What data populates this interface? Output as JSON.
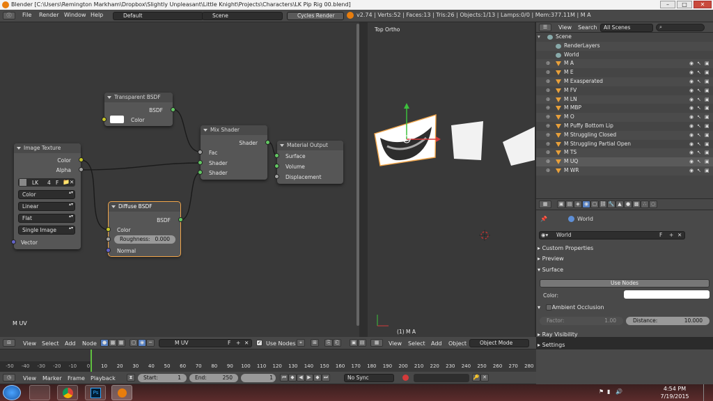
{
  "title": "Blender [C:\\Users\\Remington Markham\\Dropbox\\Slightly Unpleasant\\Little Knight\\Projects\\Characters\\LK Pip Rig 00.blend]",
  "info_header": {
    "menus": [
      "File",
      "Render",
      "Window",
      "Help"
    ],
    "layout": "Default",
    "scene": "Scene",
    "engine": "Cycles Render",
    "stats": "v2.74 | Verts:52 | Faces:13 | Tris:26 | Objects:1/13 | Lamps:0/0 | Mem:377.11M | M A"
  },
  "nodes": {
    "transparent": {
      "title": "Transparent BSDF",
      "out": "BSDF",
      "in": "Color"
    },
    "image": {
      "title": "Image Texture",
      "out_color": "Color",
      "out_alpha": "Alpha",
      "image_name": "LK",
      "users": "4",
      "f": "F",
      "color": "Color",
      "interp": "Linear",
      "proj": "Flat",
      "source": "Single Image",
      "vector": "Vector"
    },
    "diffuse": {
      "title": "Diffuse BSDF",
      "out": "BSDF",
      "color": "Color",
      "roughness_label": "Roughness:",
      "roughness": "0.000",
      "normal": "Normal"
    },
    "mix": {
      "title": "Mix Shader",
      "out": "Shader",
      "fac": "Fac",
      "shader1": "Shader",
      "shader2": "Shader"
    },
    "output": {
      "title": "Material Output",
      "surface": "Surface",
      "volume": "Volume",
      "displacement": "Displacement"
    }
  },
  "node_editor": {
    "label": "M UV",
    "header": {
      "menus": [
        "View",
        "Select",
        "Add",
        "Node"
      ],
      "material": "M UV",
      "f": "F",
      "use_nodes": "Use Nodes"
    }
  },
  "viewport": {
    "label": "Top Ortho",
    "object_label": "(1) M A",
    "header": {
      "menus": [
        "View",
        "Select",
        "Add",
        "Object"
      ],
      "mode": "Object Mode"
    }
  },
  "outliner": {
    "menus": [
      "View",
      "Search"
    ],
    "filter": "All Scenes",
    "items": [
      "Scene",
      "RenderLayers",
      "World",
      "M A",
      "M E",
      "M Exasperated",
      "M FV",
      "M LN",
      "M MBP",
      "M O",
      "M Puffy Bottom Lip",
      "M Struggling Closed",
      "M Struggling Partial Open",
      "M TS",
      "M UQ",
      "M WR"
    ]
  },
  "properties": {
    "context": "World",
    "world_name": "World",
    "f": "F",
    "panels": {
      "custom": "Custom Properties",
      "preview": "Preview",
      "surface": "Surface",
      "use_nodes": "Use Nodes",
      "color": "Color:",
      "ao": "Ambient Occlusion",
      "factor_label": "Factor:",
      "factor": "1.00",
      "distance_label": "Distance:",
      "distance": "10.000",
      "ray": "Ray Visibility",
      "settings": "Settings"
    }
  },
  "timeline": {
    "ticks": [
      "-50",
      "-40",
      "-30",
      "-20",
      "-10",
      "0",
      "10",
      "20",
      "30",
      "40",
      "50",
      "60",
      "70",
      "80",
      "90",
      "100",
      "110",
      "120",
      "130",
      "140",
      "150",
      "160",
      "170",
      "180",
      "190",
      "200",
      "210",
      "220",
      "230",
      "240",
      "250",
      "260",
      "270",
      "280"
    ],
    "menus": [
      "View",
      "Marker",
      "Frame",
      "Playback"
    ],
    "start_label": "Start:",
    "start": "1",
    "end_label": "End:",
    "end": "250",
    "current": "1",
    "sync": "No Sync"
  },
  "taskbar": {
    "time": "4:54 PM",
    "date": "7/19/2015"
  },
  "colors": {
    "accent": "#5680c2",
    "selected_outline": "#f2a64a",
    "socket_shader": "#63c763",
    "socket_color": "#c7c729",
    "socket_vector": "#6363c7"
  }
}
